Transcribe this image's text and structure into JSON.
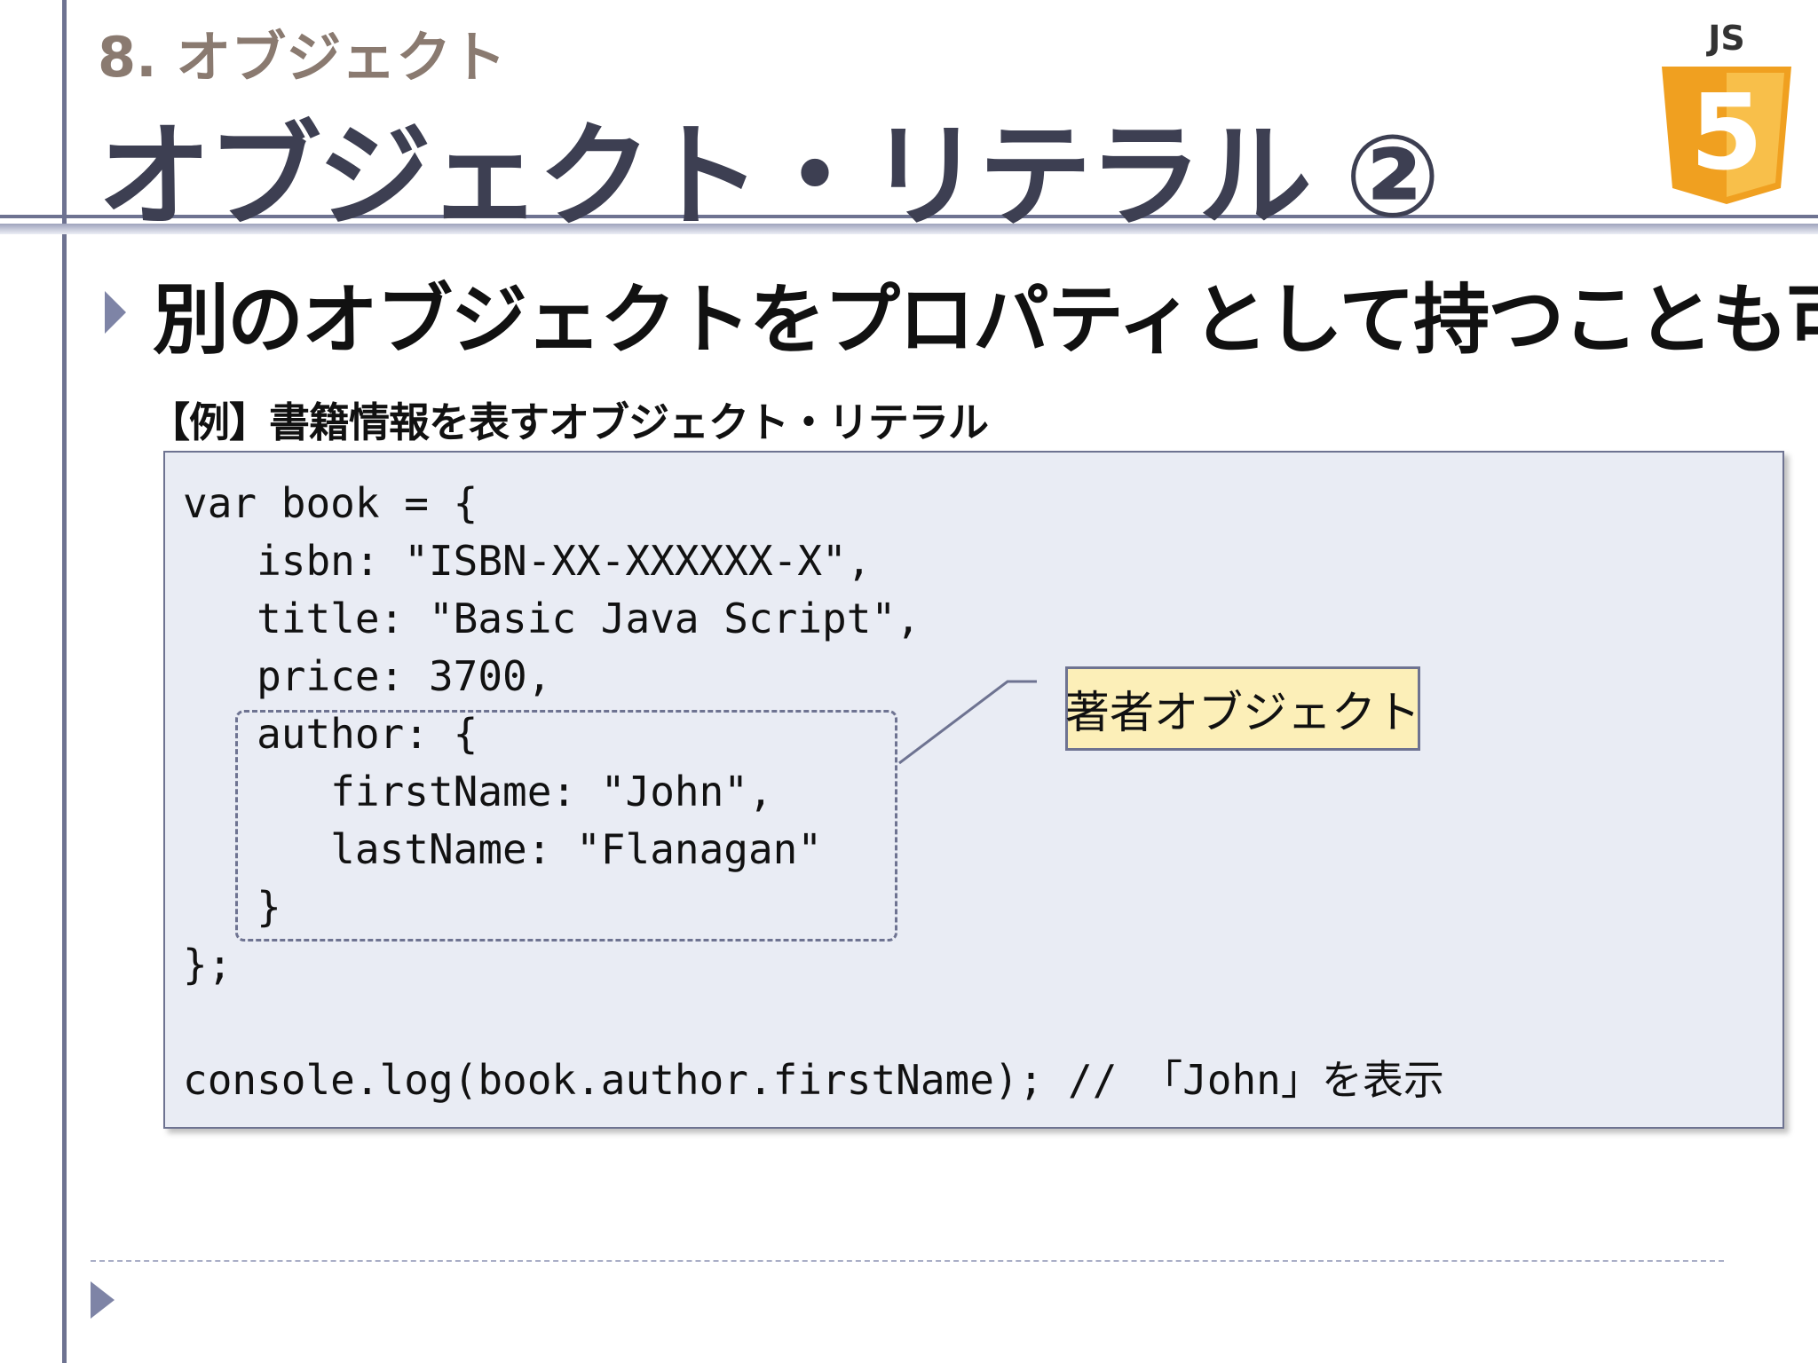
{
  "header": {
    "section": "8. オブジェクト",
    "title": "オブジェクト・リテラル ②",
    "logo_text": "JS",
    "logo_numeral": "5"
  },
  "bullet": {
    "headline": "別のオブジェクトをプロパティとして持つことも可"
  },
  "example": {
    "caption": "【例】書籍情報を表すオブジェクト・リテラル",
    "code_lines": [
      "var book = {",
      "   isbn: \"ISBN-XX-XXXXXX-X\",",
      "   title: \"Basic Java Script\",",
      "   price: 3700,",
      "   author: {",
      "      firstName: \"John\",",
      "      lastName: \"Flanagan\"",
      "   }",
      "};",
      "",
      "console.log(book.author.firstName); // 「John」を表示"
    ],
    "callout": "著者オブジェクト"
  },
  "colors": {
    "accent": "#6e7391",
    "section_text": "#8a7a70",
    "title_text": "#3d3f52",
    "code_background": "#e9ecf4",
    "callout_background": "#fcefb8",
    "logo_orange": "#f0a020"
  }
}
